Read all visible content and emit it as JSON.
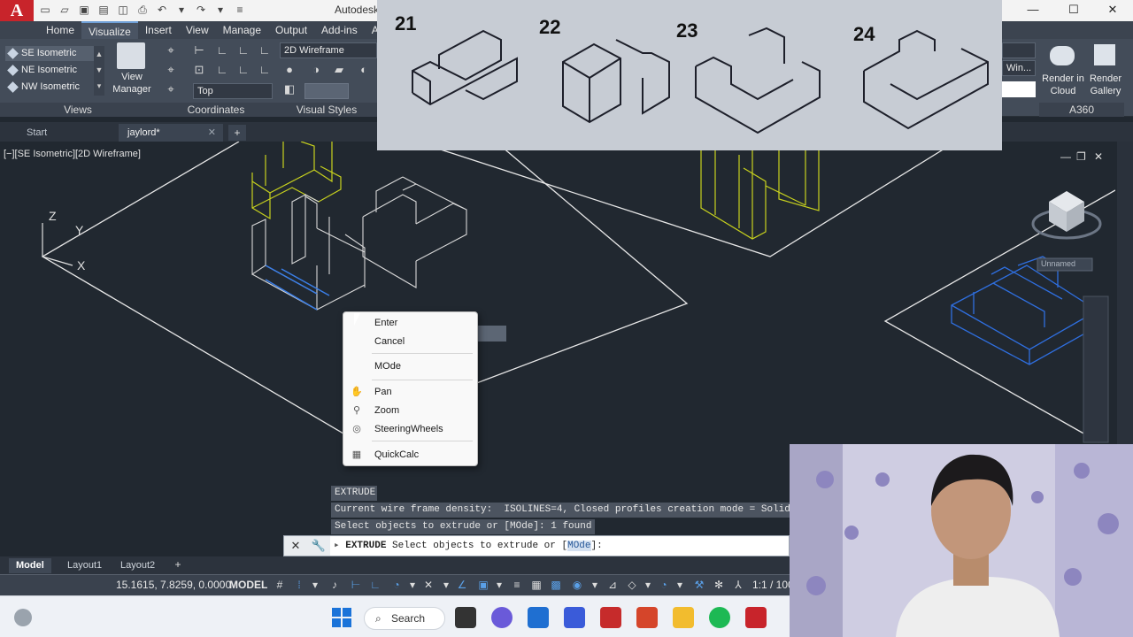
{
  "app": {
    "logo_letter": "A",
    "title": "Autodesk",
    "window_controls": [
      "—",
      "☐",
      "✕"
    ]
  },
  "ribbon": {
    "tabs": [
      {
        "label": "Home"
      },
      {
        "label": "Visualize"
      },
      {
        "label": "Insert"
      },
      {
        "label": "View"
      },
      {
        "label": "Manage"
      },
      {
        "label": "Output"
      },
      {
        "label": "Add-ins"
      },
      {
        "label": "A"
      }
    ],
    "views": {
      "items": [
        {
          "label": "SE Isometric"
        },
        {
          "label": "NE Isometric"
        },
        {
          "label": "NW Isometric"
        }
      ],
      "view_manager": "View Manager",
      "title": "Views"
    },
    "coordinates": {
      "title": "Coordinates",
      "top_dropdown": "Top"
    },
    "visual_styles": {
      "current": "2D Wireframe",
      "title": "Visual Styles"
    },
    "right": {
      "win_dropdown": "Win...",
      "render_cloud": "Render in Cloud",
      "render_gallery": "Render Gallery",
      "title": "A360"
    }
  },
  "doc_tabs": [
    {
      "label": "Start"
    },
    {
      "label": "jaylord*"
    }
  ],
  "viewport": {
    "label": "[−][SE Isometric][2D Wireframe]",
    "ucs_z": "Z",
    "ucs_y": "Y",
    "ucs_x": "X",
    "unnamed_label": "Unnamed"
  },
  "reference_photo": {
    "numbers": [
      "21",
      "22",
      "23",
      "24"
    ]
  },
  "context_menu": {
    "items": [
      {
        "label": "Enter",
        "icon": "none"
      },
      {
        "label": "Cancel",
        "icon": "none"
      },
      {
        "label": "MOde",
        "icon": "none"
      },
      {
        "label": "Pan",
        "icon": "pan-icon"
      },
      {
        "label": "Zoom",
        "icon": "zoom-icon"
      },
      {
        "label": "SteeringWheels",
        "icon": "steering-wheel-icon"
      },
      {
        "label": "QuickCalc",
        "icon": "calculator-icon"
      }
    ]
  },
  "command": {
    "history": [
      "EXTRUDE",
      "Current wire frame density:  ISOLINES=4, Closed profiles creation mode = Solid",
      "Select objects to extrude or [MOde]: 1 found"
    ],
    "input_cmd": "EXTRUDE",
    "input_text": " Select objects to extrude or [",
    "input_option": "MOde",
    "input_end": "]:"
  },
  "layout_tabs": [
    {
      "label": "Model"
    },
    {
      "label": "Layout1"
    },
    {
      "label": "Layout2"
    }
  ],
  "status": {
    "coords": "15.1615, 7.8259, 0.0000",
    "model": "MODEL",
    "scale": "1:1 / 100%"
  },
  "taskbar": {
    "search_label": "Search"
  },
  "colors": {
    "viewport_bg": "#212830",
    "accent_red": "#c8242b",
    "wire_white": "#e8e8e8",
    "wire_yellow": "#c8d21e",
    "wire_blue": "#2f6fe0"
  }
}
